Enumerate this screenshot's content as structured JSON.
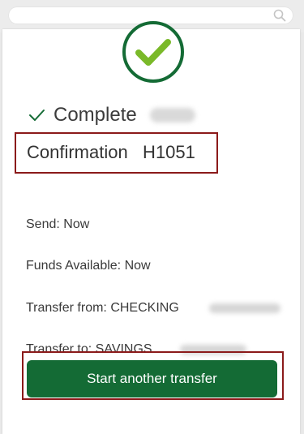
{
  "status": {
    "complete_label": "Complete",
    "amount_redacted": true
  },
  "confirmation": {
    "text": "Confirmation   H1051"
  },
  "details": {
    "send": "Send: Now",
    "funds_available": "Funds Available: Now",
    "transfer_from": "Transfer from: CHECKING",
    "transfer_to": "Transfer to: SAVINGS"
  },
  "actions": {
    "start_another": "Start another transfer"
  },
  "icons": {
    "search": "search-icon",
    "success": "success-check-icon",
    "complete": "check-icon"
  },
  "colors": {
    "brand_green": "#146b35",
    "check_green": "#7ab929",
    "highlight_red": "#8b1a1a"
  }
}
